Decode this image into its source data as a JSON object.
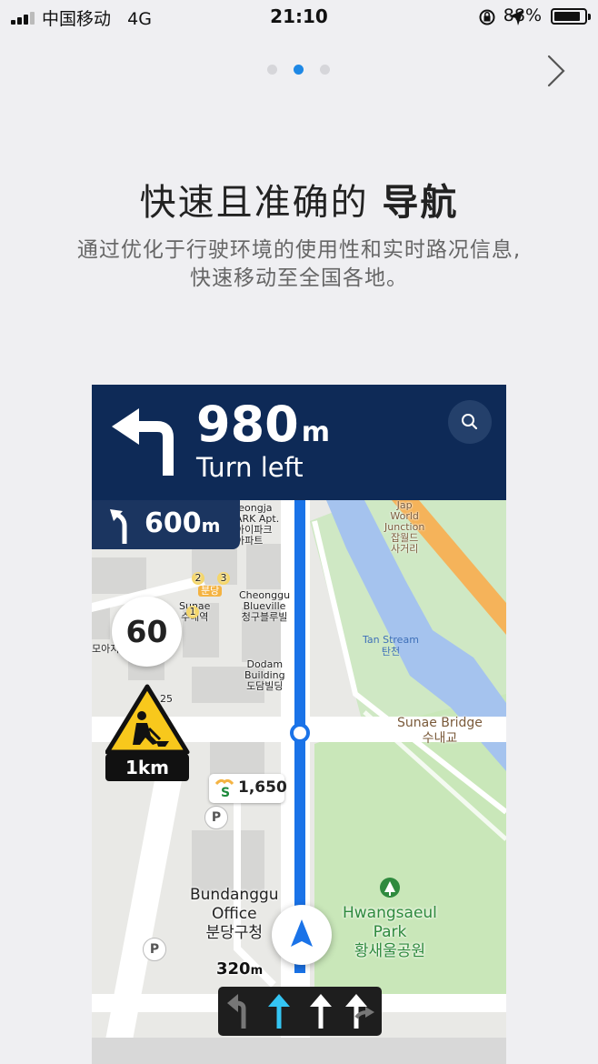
{
  "status_bar": {
    "carrier": "中国移动",
    "network": "4G",
    "time": "21:10",
    "battery": "88%",
    "battery_level": 0.88,
    "icons": [
      "signal-icon",
      "rotation-lock-icon",
      "location-arrow-icon",
      "battery-icon"
    ]
  },
  "pager": {
    "pages": 3,
    "active_index": 1,
    "next_icon": "chevron-right-icon"
  },
  "intro": {
    "title_main": "快速且准确的",
    "title_emph": "导航",
    "description_line1": "通过优化于行驶环境的使用性和实时路况信息,",
    "description_line2": "快速移动至全国各地。"
  },
  "navigation": {
    "distance": "980",
    "distance_unit": "m",
    "instruction": "Turn left",
    "next_turn_distance": "600",
    "next_turn_unit": "m",
    "speed_limit": "60",
    "hazard_distance": "1km",
    "fuel_price": "1,650",
    "remaining_distance": "320",
    "remaining_unit": "m",
    "lanes": [
      "left-turn",
      "straight-active",
      "straight",
      "straight-right"
    ],
    "colors": {
      "nav_header": "#0e2a57",
      "route": "#1a73e8",
      "river": "#a5c3ee",
      "park": "#bfe3ae"
    }
  },
  "map_labels": {
    "jeongja": [
      "Jeongja",
      "ARK Apt.",
      "아이파크",
      "아파트"
    ],
    "sunae": [
      "Sunae",
      "수내역"
    ],
    "cheonggu": [
      "Cheonggu",
      "Blueville",
      "청구블루빌"
    ],
    "dodam": [
      "Dodam",
      "Building",
      "도담빌딩"
    ],
    "jap": [
      "Jap",
      "World",
      "Junction",
      "잡월드",
      "사거리"
    ],
    "tan_stream": [
      "Tan Stream",
      "탄천"
    ],
    "sunae_bridge": [
      "Sunae Bridge",
      "수내교"
    ],
    "bundang": [
      "Bundanggu",
      "Office",
      "분당구청"
    ],
    "park": [
      "Hwangsaeul",
      "Park",
      "황새울공원"
    ],
    "moaji": "모아지",
    "num_25": "25",
    "badge_1": "2",
    "badge_2": "3",
    "badge_3": "1",
    "bundang_tag": "분당",
    "parking": "P"
  }
}
